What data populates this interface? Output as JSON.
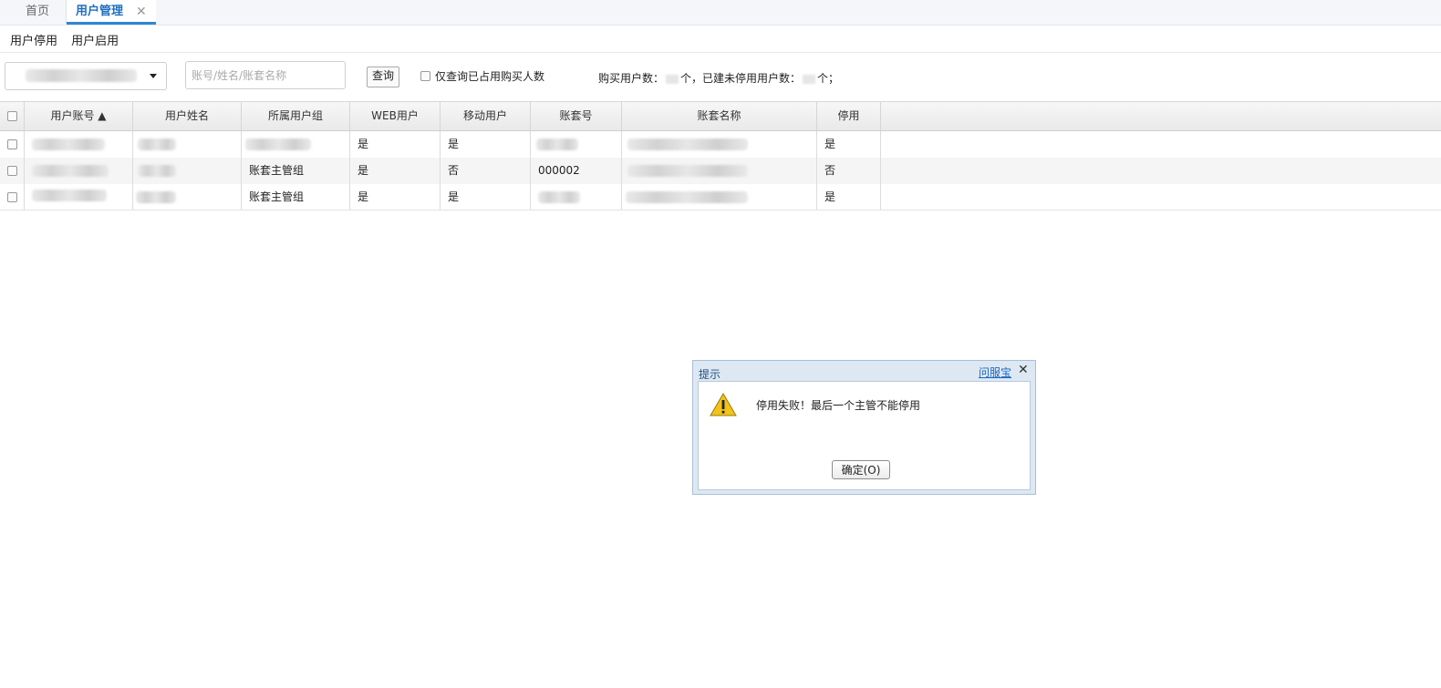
{
  "tabs": [
    {
      "label": "首页"
    },
    {
      "label": "用户管理",
      "close": "✕"
    }
  ],
  "actions": {
    "disable": "用户停用",
    "enable": "用户启用"
  },
  "filter": {
    "search_placeholder": "账号/姓名/账套名称",
    "query_label": "查询",
    "only_occupied_label": "仅查询已占用购买人数",
    "count_prefix": "购买用户数：",
    "count_mid": "个，已建未停用用户数：",
    "count_suffix": "个；"
  },
  "table": {
    "columns": [
      "用户账号 ▲",
      "用户姓名",
      "所属用户组",
      "WEB用户",
      "移动用户",
      "账套号",
      "账套名称",
      "停用"
    ],
    "rows": [
      {
        "group": "",
        "web": "是",
        "mobile": "是",
        "set_no": "",
        "disabled": "是"
      },
      {
        "group": "账套主管组",
        "web": "是",
        "mobile": "否",
        "set_no": "000002",
        "disabled": "否"
      },
      {
        "group": "账套主管组",
        "web": "是",
        "mobile": "是",
        "set_no": "",
        "disabled": "是"
      }
    ]
  },
  "dialog": {
    "title": "提示",
    "help_link": "问服宝",
    "close": "✕",
    "message": "停用失败！最后一个主管不能停用",
    "ok_label": "确定(O)"
  },
  "icons": [
    "close-icon",
    "dropdown-arrow-icon",
    "warning-icon",
    "sort-asc-icon"
  ],
  "colors": {
    "accent": "#2f86d6",
    "tab_active_text": "#1f6fbf",
    "dialog_frame": "#dde8f3",
    "warning": "#f2c318"
  }
}
